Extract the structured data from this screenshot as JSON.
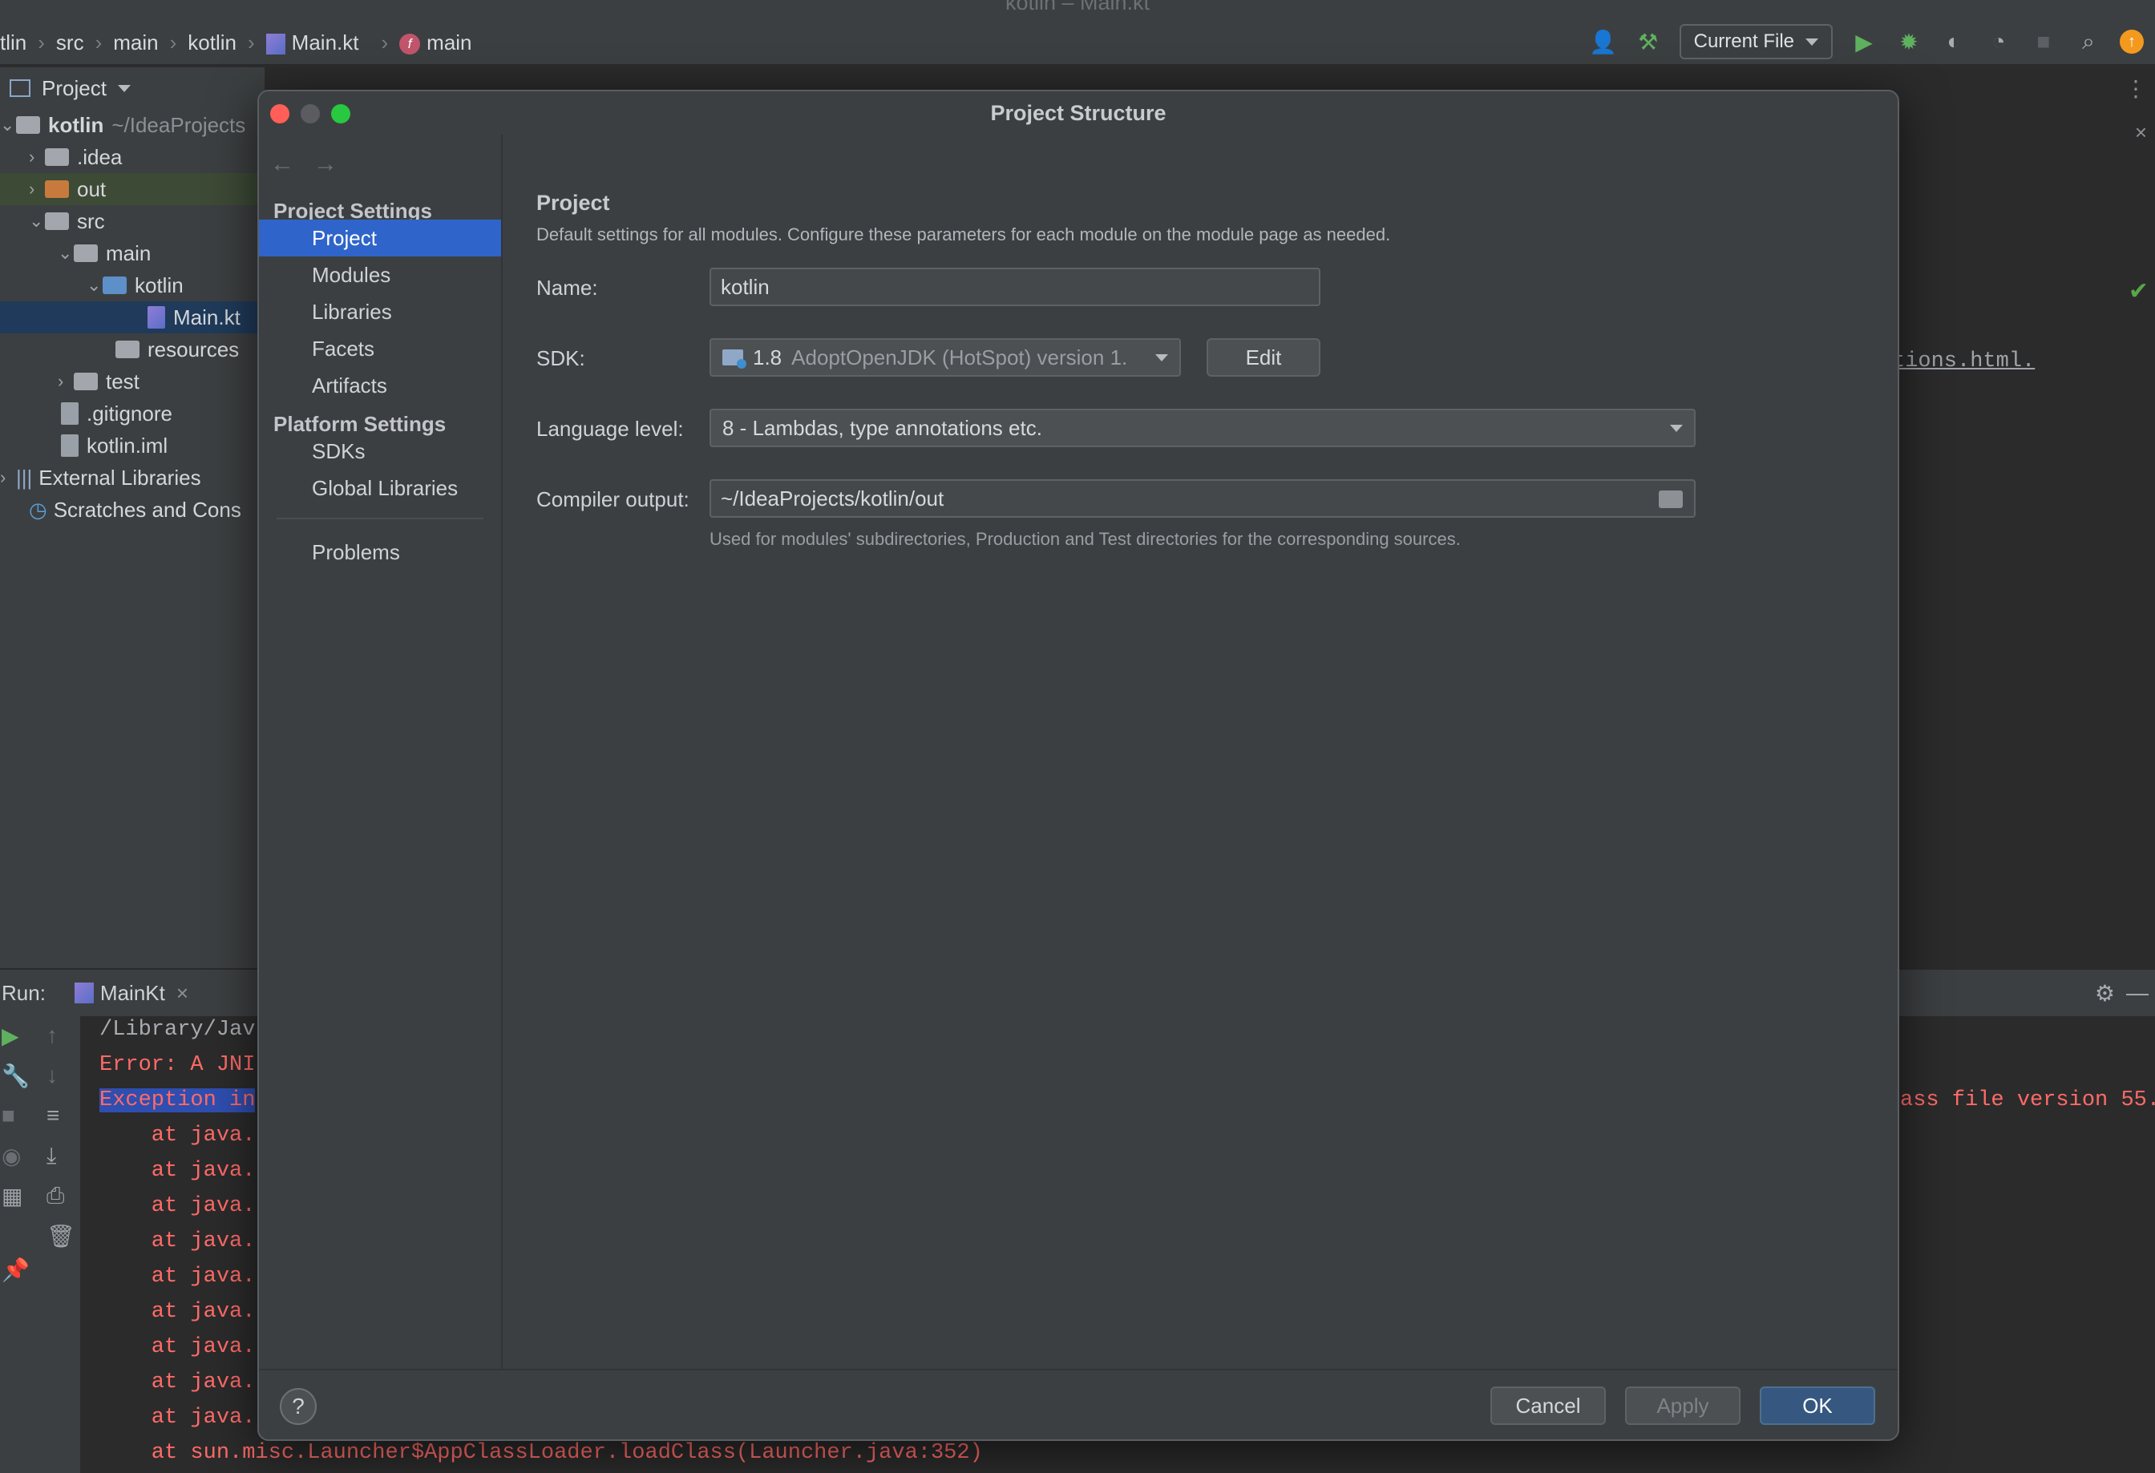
{
  "ide": {
    "window_title": "kotlin – Main.kt",
    "breadcrumbs": [
      "tlin",
      "src",
      "main",
      "kotlin",
      "Main.kt",
      "main"
    ],
    "run_config": "Current File",
    "project_header": "Project",
    "editor_fragment": "tions.html.",
    "tree": {
      "root_name": "kotlin",
      "root_path": "~/IdeaProjects",
      "idea": ".idea",
      "out": "out",
      "src": "src",
      "main": "main",
      "kotlin": "kotlin",
      "main_kt": "Main.kt",
      "resources": "resources",
      "test": "test",
      "gitignore": ".gitignore",
      "iml": "kotlin.iml",
      "ext_libs": "External Libraries",
      "scratches": "Scratches and Cons"
    },
    "run": {
      "label": "Run:",
      "tab": "MainKt",
      "right_fragment": "ass file version 55.",
      "lines": [
        "/Library/Jav",
        "Error: A JNI",
        "Exception in",
        "    at java.",
        "    at java.",
        "    at java.",
        "    at java.",
        "    at java.",
        "    at java.",
        "    at java.",
        "    at java.",
        "    at java.",
        "    at sun.misc.Launcher$AppClassLoader.loadClass(Launcher.java:352)"
      ]
    }
  },
  "dialog": {
    "title": "Project Structure",
    "sidebar": {
      "project_settings_heading": "Project Settings",
      "project_settings_items": [
        "Project",
        "Modules",
        "Libraries",
        "Facets",
        "Artifacts"
      ],
      "platform_settings_heading": "Platform Settings",
      "platform_settings_items": [
        "SDKs",
        "Global Libraries"
      ],
      "problems": "Problems"
    },
    "content": {
      "title": "Project",
      "description": "Default settings for all modules. Configure these parameters for each module on the module page as needed.",
      "name_label": "Name:",
      "name_value": "kotlin",
      "sdk_label": "SDK:",
      "sdk_version": "1.8",
      "sdk_name": "AdoptOpenJDK (HotSpot) version 1.",
      "edit_button": "Edit",
      "language_level_label": "Language level:",
      "language_level_value": "8 - Lambdas, type annotations etc.",
      "compiler_output_label": "Compiler output:",
      "compiler_output_value": "~/IdeaProjects/kotlin/out",
      "compiler_output_hint": "Used for modules' subdirectories, Production and Test directories for the corresponding sources."
    },
    "footer": {
      "help": "?",
      "cancel": "Cancel",
      "apply": "Apply",
      "ok": "OK"
    }
  },
  "colors": {
    "selection": "#2f65ca",
    "primary_button": "#365880",
    "error_text": "#ff6b68"
  }
}
